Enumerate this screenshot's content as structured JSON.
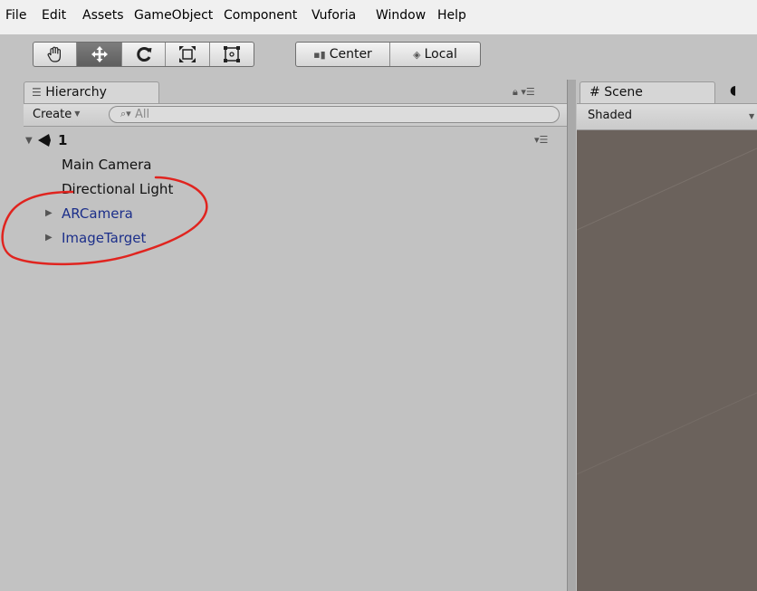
{
  "menu": {
    "items": [
      "File",
      "Edit",
      "Assets",
      "GameObject",
      "Component",
      "Vuforia",
      "Window",
      "Help"
    ]
  },
  "toolbar": {
    "tools": [
      {
        "name": "hand-tool",
        "icon": "hand-icon",
        "active": false
      },
      {
        "name": "move-tool",
        "icon": "move-arrows-icon",
        "active": true
      },
      {
        "name": "rotate-tool",
        "icon": "rotate-icon",
        "active": false
      },
      {
        "name": "scale-tool",
        "icon": "scale-icon",
        "active": false
      },
      {
        "name": "rect-tool",
        "icon": "rect-icon",
        "active": false
      }
    ],
    "pivot_label": "Center",
    "space_label": "Local"
  },
  "hierarchy": {
    "tab_label": "Hierarchy",
    "create_label": "Create",
    "search_placeholder": "All",
    "scene_name": "1",
    "items": [
      {
        "label": "Main Camera",
        "has_children": false,
        "prefab": false
      },
      {
        "label": "Directional Light",
        "has_children": false,
        "prefab": false
      },
      {
        "label": "ARCamera",
        "has_children": true,
        "prefab": true
      },
      {
        "label": "ImageTarget",
        "has_children": true,
        "prefab": true
      }
    ]
  },
  "scene": {
    "tab_label": "Scene",
    "shading_mode": "Shaded"
  },
  "colors": {
    "panel_bg": "#c2c2c2",
    "prefab_text": "#1c2f8a",
    "scene_bg": "#6b625c",
    "annotation": "#e0241f"
  }
}
